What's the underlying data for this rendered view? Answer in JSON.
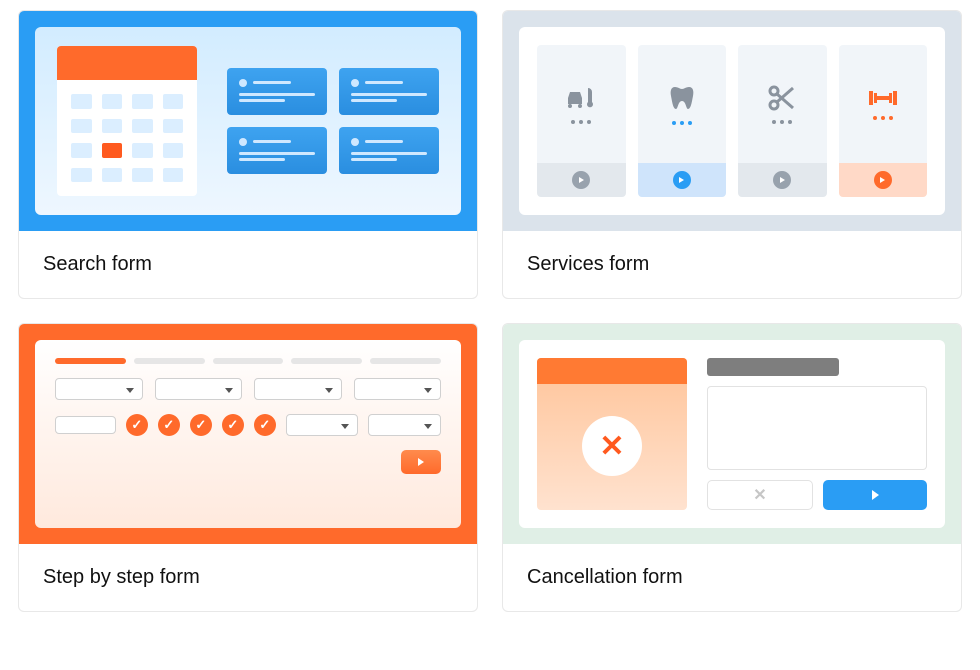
{
  "cards": {
    "search": {
      "label": "Search form"
    },
    "services": {
      "label": "Services form"
    },
    "step": {
      "label": "Step by step form"
    },
    "cancel": {
      "label": "Cancellation form"
    }
  },
  "icons": {
    "car_wrench": "car-wrench",
    "tooth": "tooth",
    "scissors": "scissors",
    "dumbbell": "dumbbell"
  }
}
